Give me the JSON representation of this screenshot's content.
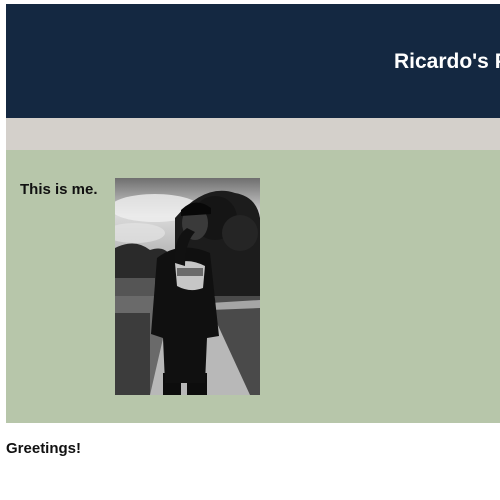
{
  "header": {
    "title": "Ricardo's P"
  },
  "content": {
    "caption": "This is me.",
    "photo": {
      "alt": "Black and white photo of a person in a cap and graphic t-shirt standing on a sidewalk"
    }
  },
  "footer": {
    "greeting": "Greetings!"
  },
  "colors": {
    "header_bg": "#142841",
    "nav_bg": "#d4d0cb",
    "content_bg": "#b7c6aa",
    "page_bg": "#ffffff"
  }
}
